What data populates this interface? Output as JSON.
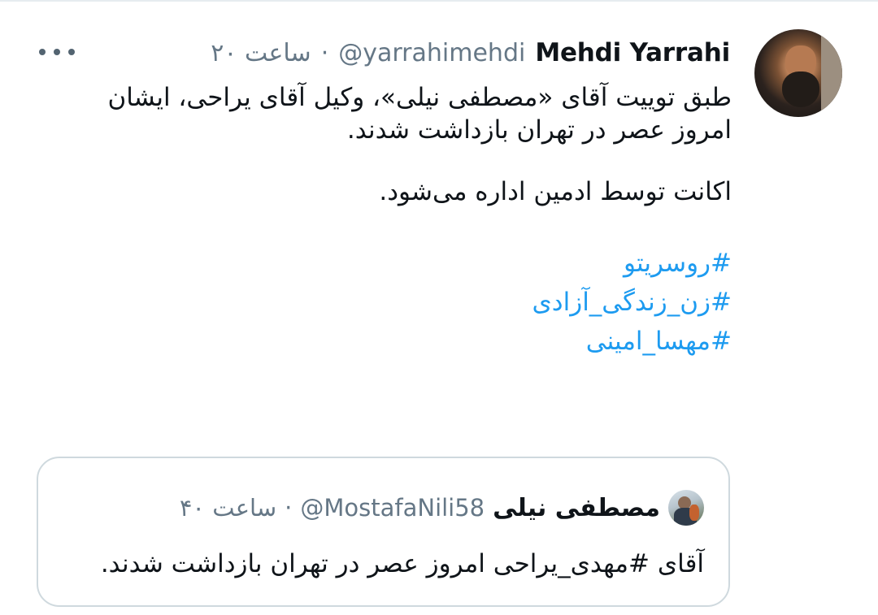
{
  "tweet": {
    "author_name": "Mehdi Yarrahi",
    "handle": "@yarrahimehdi",
    "separator": "·",
    "time": "۲۰ ساعت",
    "paragraphs": [
      "طبق توییت آقای «مصطفی نیلی»، وکیل آقای یراحی، ایشان امروز عصر در تهران بازداشت شدند.",
      "اکانت توسط ادمین اداره می‌شود."
    ],
    "hashtags": [
      "#روسریتو",
      "#زن_زندگی_آزادی",
      "#مهسا_امینی"
    ],
    "more_icon": "more-horizontal-icon"
  },
  "quoted": {
    "author_name": "مصطفی نیلی",
    "handle": "@MostafaNili58",
    "separator": "·",
    "time": "۴۰ ساعت",
    "text": "آقای #مهدی_یراحی امروز عصر در تهران بازداشت شدند."
  },
  "colors": {
    "link": "#1d9bf0",
    "secondary_text": "#657786",
    "border": "#cfd9de"
  }
}
